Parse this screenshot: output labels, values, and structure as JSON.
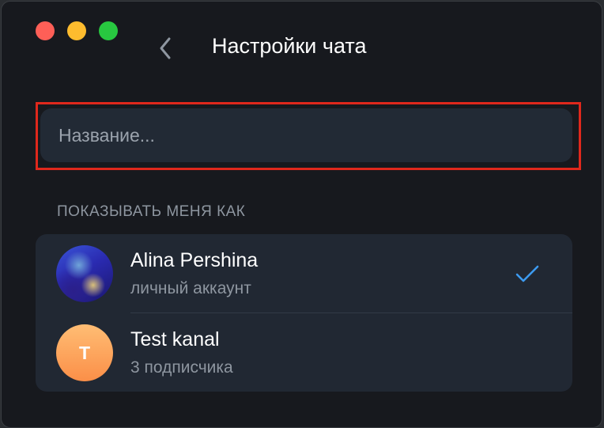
{
  "header": {
    "title": "Настройки чата",
    "back_icon": "chevron-left-icon"
  },
  "window_controls": {
    "close_color": "#fe5f57",
    "minimize_color": "#febc2e",
    "zoom_color": "#28c840"
  },
  "name_field": {
    "placeholder": "Название...",
    "value": "",
    "highlight_color": "#e0281c"
  },
  "show_me_as": {
    "label": "ПОКАЗЫВАТЬ МЕНЯ КАК",
    "items": [
      {
        "title": "Alina Pershina",
        "subtitle": "личный аккаунт",
        "avatar": "user-photo",
        "selected": true
      },
      {
        "title": "Test kanal",
        "subtitle": "3 подписчика",
        "avatar_letter": "T",
        "avatar_color": "#fb8f48",
        "selected": false
      }
    ]
  },
  "colors": {
    "accent": "#3d9bf0",
    "background": "#17191e",
    "card": "#212833"
  }
}
